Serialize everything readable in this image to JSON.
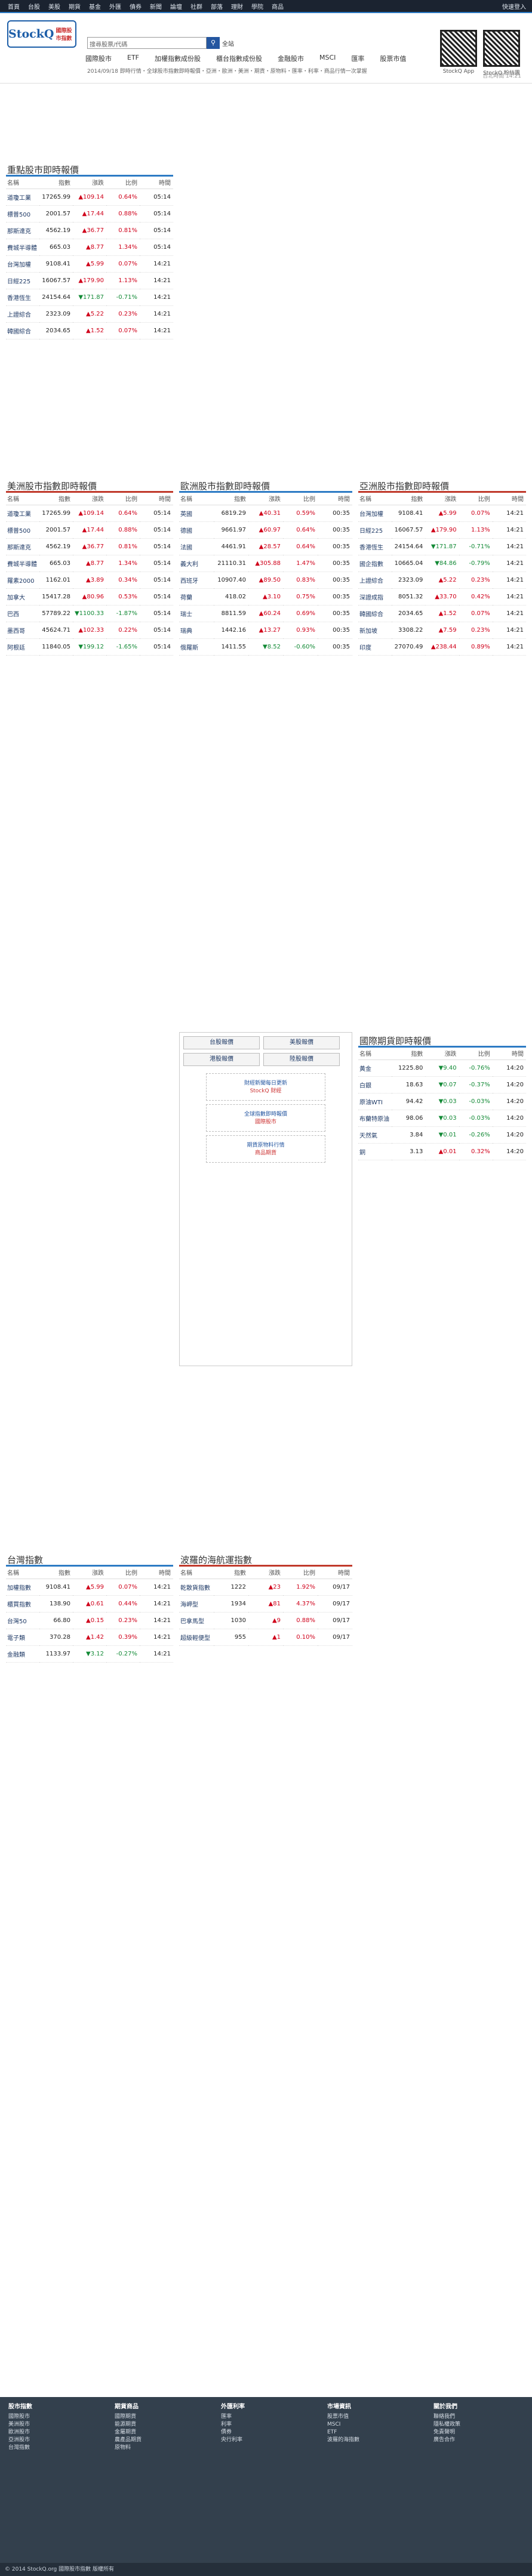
{
  "nav": {
    "items": [
      "首頁",
      "台股",
      "美股",
      "期貨",
      "基金",
      "外匯",
      "債券",
      "新聞",
      "論壇",
      "社群",
      "部落",
      "理財",
      "學院",
      "商品"
    ],
    "login": "快速登入"
  },
  "header": {
    "logo": "StockQ",
    "logo_sub": "國際股市指數",
    "search_placeholder": "搜尋股票/代碼",
    "search_scope": "全站",
    "menu": [
      "國際股市",
      "ETF",
      "加權指數成份股",
      "櫃台指數成份股",
      "金融股市",
      "MSCI",
      "匯率",
      "股票市值"
    ],
    "ticker": "2014/09/18 即時行情・全球股市指數即時報價・亞洲・歐洲・美洲・期貨・原物料・匯率・利率・商品行情一次掌握",
    "qr_labels": [
      "StockQ App",
      "StockQ 粉絲團"
    ],
    "stamp": "台北時間 14:21"
  },
  "cols": {
    "name": "名稱",
    "price": "指數",
    "chg": "漲跌",
    "pct": "比例",
    "time": "時間"
  },
  "chart_data": {
    "type": "table",
    "tables": [
      {
        "title": "重點股市即時報價",
        "rows": [
          [
            "道瓊工業",
            "17265.99",
            "▲109.14",
            "0.64%",
            "05:14"
          ],
          [
            "標普500",
            "2001.57",
            "▲17.44",
            "0.88%",
            "05:14"
          ],
          [
            "那斯達克",
            "4562.19",
            "▲36.77",
            "0.81%",
            "05:14"
          ],
          [
            "費城半導體",
            "665.03",
            "▲8.77",
            "1.34%",
            "05:14"
          ],
          [
            "台灣加權",
            "9108.41",
            "▲5.99",
            "0.07%",
            "14:21"
          ],
          [
            "日經225",
            "16067.57",
            "▲179.90",
            "1.13%",
            "14:21"
          ],
          [
            "香港恆生",
            "24154.64",
            "▼171.87",
            "-0.71%",
            "14:21"
          ],
          [
            "上證綜合",
            "2323.09",
            "▲5.22",
            "0.23%",
            "14:21"
          ],
          [
            "韓國綜合",
            "2034.65",
            "▲1.52",
            "0.07%",
            "14:21"
          ]
        ]
      },
      {
        "title": "美洲股市指數即時報價",
        "rows": [
          [
            "道瓊工業",
            "17265.99",
            "▲109.14",
            "0.64%",
            "05:14"
          ],
          [
            "標普500",
            "2001.57",
            "▲17.44",
            "0.88%",
            "05:14"
          ],
          [
            "那斯達克",
            "4562.19",
            "▲36.77",
            "0.81%",
            "05:14"
          ],
          [
            "費城半導體",
            "665.03",
            "▲8.77",
            "1.34%",
            "05:14"
          ],
          [
            "羅素2000",
            "1162.01",
            "▲3.89",
            "0.34%",
            "05:14"
          ],
          [
            "加拿大",
            "15417.28",
            "▲80.96",
            "0.53%",
            "05:14"
          ],
          [
            "巴西",
            "57789.22",
            "▼1100.33",
            "-1.87%",
            "05:14"
          ],
          [
            "墨西哥",
            "45624.71",
            "▲102.33",
            "0.22%",
            "05:14"
          ],
          [
            "阿根廷",
            "11840.05",
            "▼199.12",
            "-1.65%",
            "05:14"
          ]
        ]
      },
      {
        "title": "歐洲股市指數即時報價",
        "rows": [
          [
            "英國",
            "6819.29",
            "▲40.31",
            "0.59%",
            "00:35"
          ],
          [
            "德國",
            "9661.97",
            "▲60.97",
            "0.64%",
            "00:35"
          ],
          [
            "法國",
            "4461.91",
            "▲28.57",
            "0.64%",
            "00:35"
          ],
          [
            "義大利",
            "21110.31",
            "▲305.88",
            "1.47%",
            "00:35"
          ],
          [
            "西班牙",
            "10907.40",
            "▲89.50",
            "0.83%",
            "00:35"
          ],
          [
            "荷蘭",
            "418.02",
            "▲3.10",
            "0.75%",
            "00:35"
          ],
          [
            "瑞士",
            "8811.59",
            "▲60.24",
            "0.69%",
            "00:35"
          ],
          [
            "瑞典",
            "1442.16",
            "▲13.27",
            "0.93%",
            "00:35"
          ],
          [
            "俄羅斯",
            "1411.55",
            "▼8.52",
            "-0.60%",
            "00:35"
          ]
        ]
      },
      {
        "title": "亞洲股市指數即時報價",
        "rows": [
          [
            "台灣加權",
            "9108.41",
            "▲5.99",
            "0.07%",
            "14:21"
          ],
          [
            "日經225",
            "16067.57",
            "▲179.90",
            "1.13%",
            "14:21"
          ],
          [
            "香港恆生",
            "24154.64",
            "▼171.87",
            "-0.71%",
            "14:21"
          ],
          [
            "國企指數",
            "10665.04",
            "▼84.86",
            "-0.79%",
            "14:21"
          ],
          [
            "上證綜合",
            "2323.09",
            "▲5.22",
            "0.23%",
            "14:21"
          ],
          [
            "深證成指",
            "8051.32",
            "▲33.70",
            "0.42%",
            "14:21"
          ],
          [
            "韓國綜合",
            "2034.65",
            "▲1.52",
            "0.07%",
            "14:21"
          ],
          [
            "新加坡",
            "3308.22",
            "▲7.59",
            "0.23%",
            "14:21"
          ],
          [
            "印度",
            "27070.49",
            "▲238.44",
            "0.89%",
            "14:21"
          ]
        ]
      },
      {
        "title": "台灣指數",
        "rows": [
          [
            "加權指數",
            "9108.41",
            "▲5.99",
            "0.07%",
            "14:21"
          ],
          [
            "櫃買指數",
            "138.90",
            "▲0.61",
            "0.44%",
            "14:21"
          ],
          [
            "台灣50",
            "66.80",
            "▲0.15",
            "0.23%",
            "14:21"
          ],
          [
            "電子類",
            "370.28",
            "▲1.42",
            "0.39%",
            "14:21"
          ],
          [
            "金融類",
            "1133.97",
            "▼3.12",
            "-0.27%",
            "14:21"
          ]
        ]
      },
      {
        "title": "波羅的海航運指數",
        "rows": [
          [
            "乾散貨指數",
            "1222",
            "▲23",
            "1.92%",
            "09/17"
          ],
          [
            "海岬型",
            "1934",
            "▲81",
            "4.37%",
            "09/17"
          ],
          [
            "巴拿馬型",
            "1030",
            "▲9",
            "0.88%",
            "09/17"
          ],
          [
            "超級輕便型",
            "955",
            "▲1",
            "0.10%",
            "09/17"
          ]
        ]
      },
      {
        "title": "國際期貨即時報價",
        "rows": [
          [
            "黃金",
            "1225.80",
            "▼9.40",
            "-0.76%",
            "14:20"
          ],
          [
            "白銀",
            "18.63",
            "▼0.07",
            "-0.37%",
            "14:20"
          ],
          [
            "原油WTI",
            "94.42",
            "▼0.03",
            "-0.03%",
            "14:20"
          ],
          [
            "布蘭特原油",
            "98.06",
            "▼0.03",
            "-0.03%",
            "14:20"
          ],
          [
            "天然氣",
            "3.84",
            "▼0.01",
            "-0.26%",
            "14:20"
          ],
          [
            "銅",
            "3.13",
            "▲0.01",
            "0.32%",
            "14:20"
          ]
        ]
      }
    ]
  },
  "mid_links": [
    "台股報價",
    "美股報價",
    "港股報價",
    "陸股報價"
  ],
  "ads": [
    {
      "t": "財經新聞每日更新",
      "b": "StockQ 財經"
    },
    {
      "t": "全球指數即時報價",
      "b": "國際股市"
    },
    {
      "t": "期貨原物料行情",
      "b": "商品期貨"
    }
  ],
  "footer": {
    "cols": [
      {
        "h": "股市指數",
        "items": [
          "國際股市",
          "美洲股市",
          "歐洲股市",
          "亞洲股市",
          "台灣指數"
        ]
      },
      {
        "h": "期貨商品",
        "items": [
          "國際期貨",
          "能源期貨",
          "金屬期貨",
          "農產品期貨",
          "原物料"
        ]
      },
      {
        "h": "外匯利率",
        "items": [
          "匯率",
          "利率",
          "債券",
          "央行利率"
        ]
      },
      {
        "h": "市場資訊",
        "items": [
          "股票市值",
          "MSCI",
          "ETF",
          "波羅的海指數"
        ]
      },
      {
        "h": "關於我們",
        "items": [
          "聯絡我們",
          "隱私權政策",
          "免責聲明",
          "廣告合作"
        ]
      }
    ],
    "copyright": "© 2014 StockQ.org 國際股市指數 版權所有"
  }
}
